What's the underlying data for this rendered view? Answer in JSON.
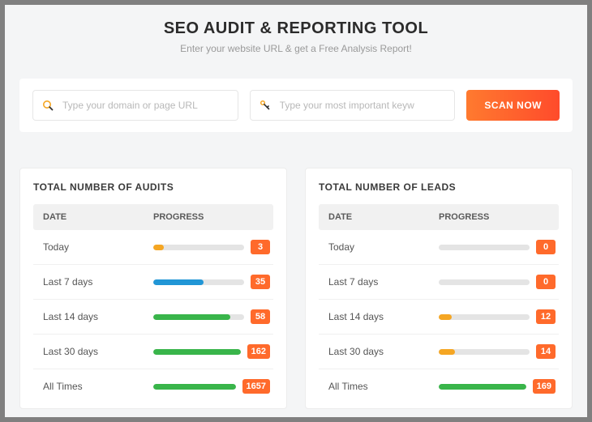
{
  "hero": {
    "title": "SEO AUDIT & REPORTING TOOL",
    "subtitle": "Enter your website URL & get a Free Analysis Report!"
  },
  "search": {
    "domain_placeholder": "Type your domain or page URL",
    "keyword_placeholder": "Type your most important keyw",
    "scan_label": "SCAN NOW"
  },
  "colors": {
    "orange": "#f5a623",
    "blue": "#2196d6",
    "green": "#39b54a",
    "badge": "#ff6a2b"
  },
  "panels": [
    {
      "title": "TOTAL NUMBER OF AUDITS",
      "headers": {
        "date": "DATE",
        "progress": "PROGRESS"
      },
      "rows": [
        {
          "label": "Today",
          "value": 3,
          "pct": 12,
          "color": "#f5a623"
        },
        {
          "label": "Last 7 days",
          "value": 35,
          "pct": 55,
          "color": "#2196d6"
        },
        {
          "label": "Last 14 days",
          "value": 58,
          "pct": 85,
          "color": "#39b54a"
        },
        {
          "label": "Last 30 days",
          "value": 162,
          "pct": 100,
          "color": "#39b54a"
        },
        {
          "label": "All Times",
          "value": 1657,
          "pct": 100,
          "color": "#39b54a"
        }
      ]
    },
    {
      "title": "TOTAL NUMBER OF LEADS",
      "headers": {
        "date": "DATE",
        "progress": "PROGRESS"
      },
      "rows": [
        {
          "label": "Today",
          "value": 0,
          "pct": 0,
          "color": "#e4e4e4"
        },
        {
          "label": "Last 7 days",
          "value": 0,
          "pct": 0,
          "color": "#e4e4e4"
        },
        {
          "label": "Last 14 days",
          "value": 12,
          "pct": 14,
          "color": "#f5a623"
        },
        {
          "label": "Last 30 days",
          "value": 14,
          "pct": 18,
          "color": "#f5a623"
        },
        {
          "label": "All Times",
          "value": 169,
          "pct": 100,
          "color": "#39b54a"
        }
      ]
    }
  ]
}
